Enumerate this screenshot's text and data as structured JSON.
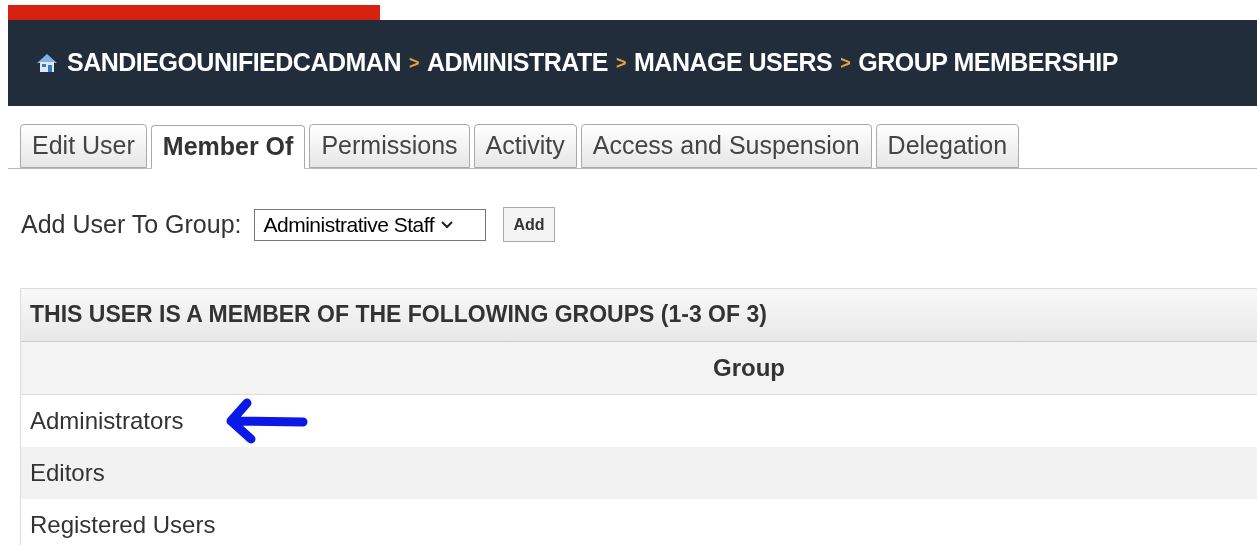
{
  "breadcrumb": {
    "separator": ">",
    "items": [
      "SANDIEGOUNIFIEDCADMAN",
      "ADMINISTRATE",
      "MANAGE USERS",
      "GROUP MEMBERSHIP"
    ]
  },
  "tabs": [
    {
      "label": "Edit User",
      "selected": false
    },
    {
      "label": "Member Of",
      "selected": true
    },
    {
      "label": "Permissions",
      "selected": false
    },
    {
      "label": "Activity",
      "selected": false
    },
    {
      "label": "Access and Suspension",
      "selected": false
    },
    {
      "label": "Delegation",
      "selected": false
    }
  ],
  "add_group": {
    "label": "Add User To Group:",
    "value": "Administrative Staff",
    "button": "Add"
  },
  "table": {
    "title": "THIS USER IS A MEMBER OF THE FOLLOWING GROUPS (1-3 OF 3)",
    "columns": [
      "Group"
    ],
    "rows": [
      {
        "group": "Administrators",
        "annotated": true
      },
      {
        "group": "Editors",
        "annotated": false
      },
      {
        "group": "Registered Users",
        "annotated": false
      }
    ]
  }
}
